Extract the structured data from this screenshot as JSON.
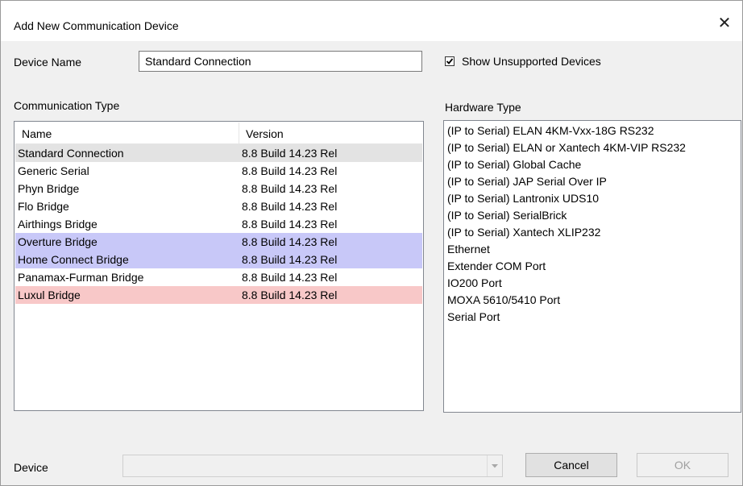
{
  "window": {
    "title": "Add New Communication Device",
    "close_glyph": "✕"
  },
  "device_name": {
    "label": "Device Name",
    "value": "Standard Connection"
  },
  "show_unsupported": {
    "label": "Show Unsupported Devices",
    "checked": true
  },
  "communication_type": {
    "label": "Communication Type",
    "columns": [
      "Name",
      "Version"
    ],
    "rows": [
      {
        "name": "Standard Connection",
        "version": "8.8 Build 14.23 Rel",
        "bg": "#e3e3e3"
      },
      {
        "name": "Generic Serial",
        "version": "8.8 Build 14.23 Rel",
        "bg": "#ffffff"
      },
      {
        "name": "Phyn Bridge",
        "version": "8.8 Build 14.23 Rel",
        "bg": "#ffffff"
      },
      {
        "name": "Flo Bridge",
        "version": "8.8 Build 14.23 Rel",
        "bg": "#ffffff"
      },
      {
        "name": "Airthings Bridge",
        "version": "8.8 Build 14.23 Rel",
        "bg": "#ffffff"
      },
      {
        "name": "Overture Bridge",
        "version": "8.8 Build 14.23 Rel",
        "bg": "#c8c8f8"
      },
      {
        "name": "Home Connect Bridge",
        "version": "8.8 Build 14.23 Rel",
        "bg": "#c8c8f8"
      },
      {
        "name": "Panamax-Furman Bridge",
        "version": "8.8 Build 14.23 Rel",
        "bg": "#ffffff"
      },
      {
        "name": "Luxul Bridge",
        "version": "8.8 Build 14.23 Rel",
        "bg": "#f8c8c8"
      }
    ]
  },
  "hardware_type": {
    "label": "Hardware Type",
    "items": [
      "(IP to Serial) ELAN 4KM-Vxx-18G  RS232",
      "(IP to Serial) ELAN or Xantech 4KM-VIP RS232",
      "(IP to Serial) Global Cache",
      "(IP to Serial) JAP Serial Over IP",
      "(IP to Serial) Lantronix UDS10",
      "(IP to Serial) SerialBrick",
      "(IP to Serial) Xantech XLIP232",
      "Ethernet",
      "Extender COM Port",
      "IO200 Port",
      "MOXA 5610/5410 Port",
      "Serial Port"
    ]
  },
  "device": {
    "label": "Device",
    "value": ""
  },
  "buttons": {
    "cancel": "Cancel",
    "ok": "OK"
  },
  "icons": {
    "close": "close-icon",
    "check": "checkmark-icon",
    "dropdown": "chevron-down-icon"
  }
}
